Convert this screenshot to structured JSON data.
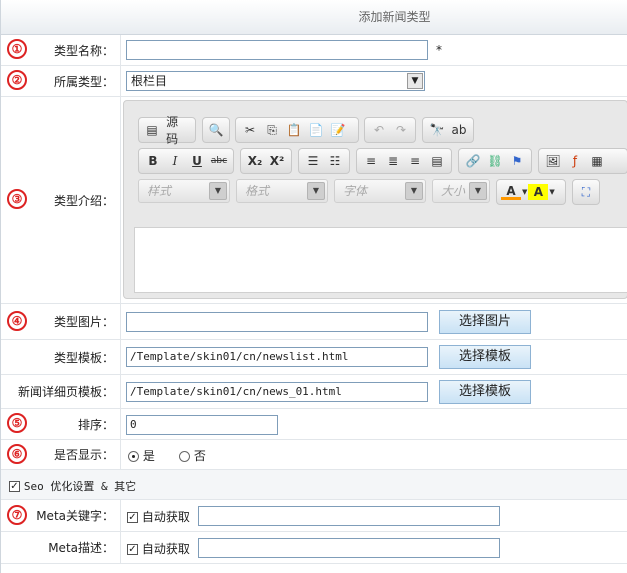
{
  "title": "添加新闻类型",
  "markers": [
    "①",
    "②",
    "③",
    "④",
    "⑤",
    "⑥",
    "⑦"
  ],
  "fields": {
    "name": {
      "label": "类型名称：",
      "value": "",
      "required_mark": "*"
    },
    "parent": {
      "label": "所属类型：",
      "selected": "根栏目"
    },
    "intro": {
      "label": "类型介绍："
    },
    "image": {
      "label": "类型图片：",
      "value": "",
      "button": "选择图片"
    },
    "template": {
      "label": "类型模板：",
      "value": "/Template/skin01/cn/newslist.html",
      "button": "选择模板"
    },
    "detail_template": {
      "label": "新闻详细页模板：",
      "value": "/Template/skin01/cn/news_01.html",
      "button": "选择模板"
    },
    "sort": {
      "label": "排序：",
      "value": "0"
    },
    "visible": {
      "label": "是否显示：",
      "yes": "是",
      "no": "否",
      "selected": "是"
    },
    "seo_section": {
      "label": "Seo 优化设置 & 其它",
      "checked": true
    },
    "meta_keywords": {
      "label": "Meta关键字：",
      "auto_label": "自动获取",
      "auto_checked": true,
      "value": ""
    },
    "meta_description": {
      "label": "Meta描述：",
      "auto_label": "自动获取",
      "auto_checked": true,
      "value": ""
    }
  },
  "editor": {
    "source_label": "源码",
    "style_combo": "样式",
    "format_combo": "格式",
    "font_combo": "字体",
    "size_combo": "大小",
    "bold": "B",
    "italic": "I",
    "underline": "U",
    "strike": "abc",
    "subscript": "X₂",
    "superscript": "X²",
    "font_color": "A",
    "bg_color": "A"
  }
}
